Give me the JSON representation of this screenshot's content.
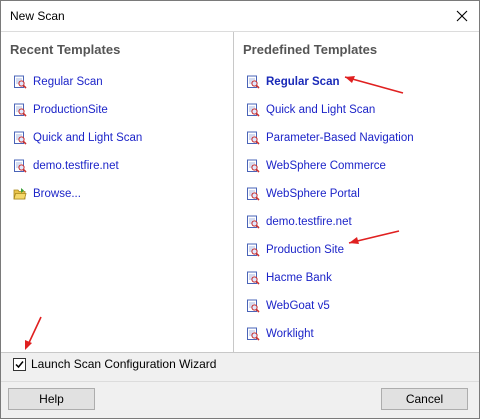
{
  "window": {
    "title": "New Scan"
  },
  "recent_templates": {
    "header": "Recent Templates",
    "items": [
      {
        "label": "Regular Scan",
        "icon": "scan-template-icon"
      },
      {
        "label": "ProductionSite",
        "icon": "scan-template-icon"
      },
      {
        "label": "Quick and Light Scan",
        "icon": "scan-template-icon"
      },
      {
        "label": "demo.testfire.net",
        "icon": "scan-template-icon"
      },
      {
        "label": "Browse...",
        "icon": "folder-open-icon"
      }
    ]
  },
  "predefined_templates": {
    "header": "Predefined Templates",
    "items": [
      {
        "label": "Regular Scan",
        "icon": "scan-template-icon",
        "selected": true
      },
      {
        "label": "Quick and Light Scan",
        "icon": "scan-template-icon"
      },
      {
        "label": "Parameter-Based Navigation",
        "icon": "scan-template-icon"
      },
      {
        "label": "WebSphere Commerce",
        "icon": "scan-template-icon"
      },
      {
        "label": "WebSphere Portal",
        "icon": "scan-template-icon"
      },
      {
        "label": "demo.testfire.net",
        "icon": "scan-template-icon"
      },
      {
        "label": "Production Site",
        "icon": "scan-template-icon"
      },
      {
        "label": "Hacme Bank",
        "icon": "scan-template-icon"
      },
      {
        "label": "WebGoat v5",
        "icon": "scan-template-icon"
      },
      {
        "label": "Worklight",
        "icon": "scan-template-icon"
      }
    ]
  },
  "wizard_checkbox": {
    "label": "Launch Scan Configuration Wizard",
    "checked": true
  },
  "buttons": {
    "help": "Help",
    "cancel": "Cancel"
  },
  "colors": {
    "link": "#1c24c8",
    "annotation_arrow": "#e02020"
  }
}
